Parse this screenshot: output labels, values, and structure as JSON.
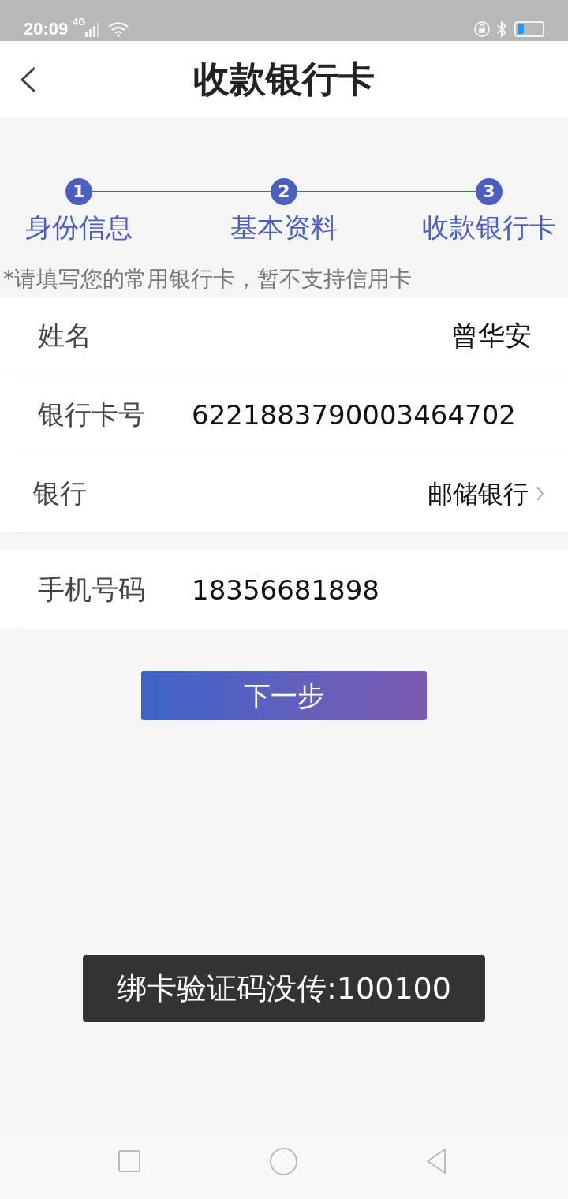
{
  "status_bar": {
    "time": "20:09",
    "network": "4G"
  },
  "header": {
    "title": "收款银行卡"
  },
  "steps": [
    {
      "number": "1",
      "label": "身份信息"
    },
    {
      "number": "2",
      "label": "基本资料"
    },
    {
      "number": "3",
      "label": "收款银行卡"
    }
  ],
  "note": "*请填写您的常用银行卡，暂不支持信用卡",
  "form_groups": [
    [
      {
        "kind": "righttext",
        "label": "姓名",
        "value": "曾华安"
      },
      {
        "kind": "text",
        "label": "银行卡号",
        "value": "6221883790003464702"
      },
      {
        "kind": "select",
        "label": "银行",
        "value": "邮储银行"
      }
    ],
    [
      {
        "kind": "text",
        "label": "手机号码",
        "value": "18356681898"
      }
    ]
  ],
  "next_button": "下一步",
  "toast": "绑卡验证码没传:100100"
}
